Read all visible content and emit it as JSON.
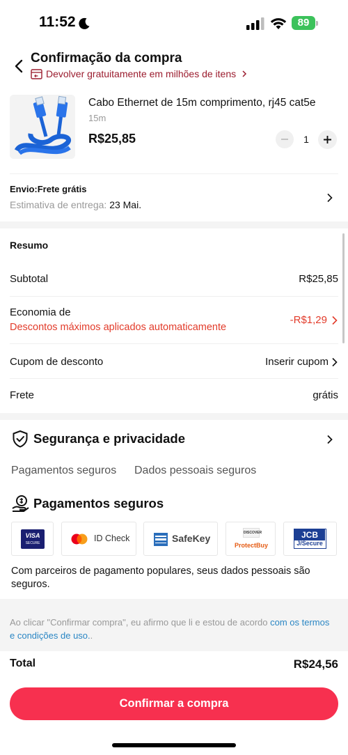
{
  "status_bar": {
    "time": "11:52",
    "battery": "89"
  },
  "header": {
    "title": "Confirmação da compra",
    "return_text": "Devolver gratuitamente em milhões de itens"
  },
  "product": {
    "name": "Cabo Ethernet de 15m comprimento, rj45 cat5e",
    "variant": "15m",
    "price": "R$25,85",
    "quantity": "1"
  },
  "shipping": {
    "label": "Envio:Frete grátis",
    "estimate_label": "Estimativa de entrega:",
    "estimate_date": "23 Mai."
  },
  "summary": {
    "title": "Resumo",
    "subtotal_label": "Subtotal",
    "subtotal_value": "R$25,85",
    "savings_label": "Economia de",
    "savings_note": "Descontos máximos aplicados automaticamente",
    "savings_value": "-R$1,29",
    "coupon_label": "Cupom de desconto",
    "coupon_value": "Inserir cupom",
    "freight_label": "Frete",
    "freight_value": "grátis"
  },
  "security": {
    "title": "Segurança e privacidade",
    "sub1": "Pagamentos seguros",
    "sub2": "Dados pessoais seguros",
    "payments_title": "Pagamentos seguros",
    "badges": {
      "visa_top": "VISA",
      "visa_bottom": "SECURE",
      "mc_label": "ID Check",
      "amex_label": "SafeKey",
      "discover_top": "DISCOVER",
      "discover_bottom": "ProtectBuy",
      "jcb_top": "JCB",
      "jcb_bottom": "J/Secure"
    },
    "description": "Com parceiros de pagamento populares, seus dados pessoais são seguros."
  },
  "terms": {
    "text": "Ao clicar \"Confirmar compra\", eu afirmo que li e estou de acordo ",
    "link": "com os termos e condições de uso.",
    "tail": "."
  },
  "footer": {
    "total_label": "Total",
    "total_value": "R$24,56",
    "confirm_label": "Confirmar a compra"
  },
  "colors": {
    "accent": "#f7304f",
    "discount": "#e23b2a",
    "link": "#2a86c4",
    "return_text": "#9b1c2e",
    "battery": "#3cc25b"
  }
}
